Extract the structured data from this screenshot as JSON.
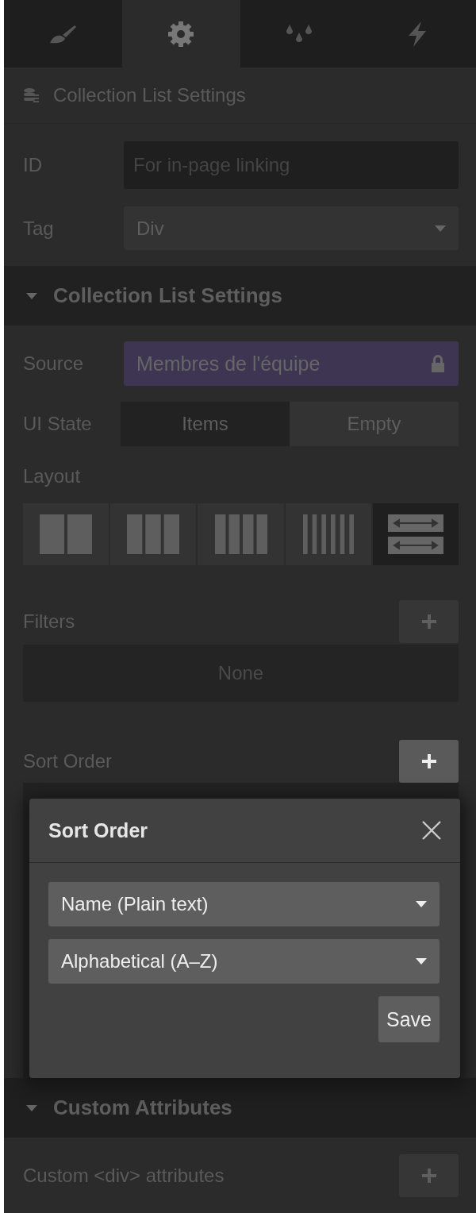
{
  "tabs": [
    {
      "kind": "brush",
      "selected": false
    },
    {
      "kind": "gear",
      "selected": true
    },
    {
      "kind": "drops",
      "selected": false
    },
    {
      "kind": "bolt",
      "selected": false
    }
  ],
  "element_header": {
    "title": "Collection List Settings"
  },
  "id_field": {
    "label": "ID",
    "placeholder": "For in-page linking"
  },
  "tag_field": {
    "label": "Tag",
    "value": "Div"
  },
  "section": {
    "title": "Collection List Settings",
    "expanded": true
  },
  "source": {
    "label": "Source",
    "value": "Membres de l'équipe",
    "locked": true
  },
  "ui_state": {
    "label": "UI State",
    "options": [
      {
        "label": "Items",
        "selected": true
      },
      {
        "label": "Empty",
        "selected": false
      }
    ]
  },
  "layout": {
    "label": "Layout",
    "options": [
      {
        "kind": "halves",
        "selected": false
      },
      {
        "kind": "thirds",
        "selected": false
      },
      {
        "kind": "quarters",
        "selected": false
      },
      {
        "kind": "sixths",
        "selected": false
      },
      {
        "kind": "rows",
        "selected": true
      }
    ]
  },
  "filters": {
    "label": "Filters",
    "empty_text": "None"
  },
  "sort_order": {
    "label": "Sort Order",
    "add_active": true
  },
  "popover": {
    "title": "Sort Order",
    "field": "Name (Plain text)",
    "direction": "Alphabetical (A–Z)",
    "save": "Save"
  },
  "custom_section": {
    "title": "Custom Attributes",
    "expanded": true
  },
  "custom_attributes": {
    "label": "Custom <div> attributes"
  }
}
